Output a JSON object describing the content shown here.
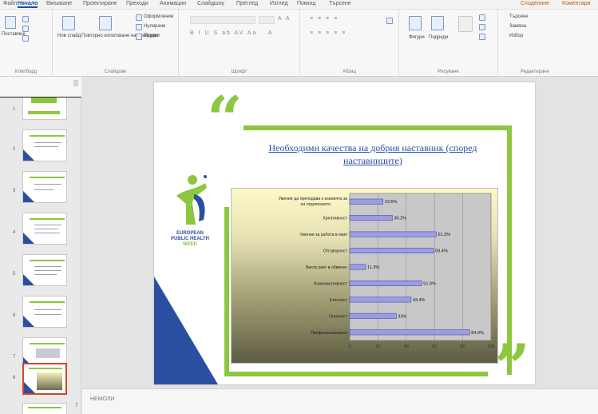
{
  "ribbon": {
    "tabs": [
      "Файл",
      "Начало",
      "Вмъкване",
      "Проектиране",
      "Преходи",
      "Анимации",
      "Слайдшоу",
      "Преглед",
      "Изглед",
      "Помощ",
      "Търсене"
    ],
    "active_tab": "Начало",
    "share_label": "Споделяне",
    "comments_label": "Коментари",
    "clipboard": {
      "paste": "Поставяне",
      "label": "Клипборд"
    },
    "slides": {
      "new_slide": "Нов слайд",
      "reuse": "Повторно използване на слайдове",
      "layout": "Оформление",
      "reset": "Нулиране",
      "section": "Раздел",
      "label": "Слайдове"
    },
    "font": {
      "label": "Шрифт"
    },
    "paragraph": {
      "label": "Абзац"
    },
    "drawing": {
      "shapes": "Фигури",
      "arrange": "Подреди",
      "label": "Рисуване"
    },
    "editing": {
      "find": "Търсене",
      "replace": "Замяна",
      "select": "Избор",
      "label": "Редактиране"
    }
  },
  "thumbnails": {
    "numbers": [
      "1",
      "2",
      "3",
      "4",
      "5",
      "6",
      "7",
      "8"
    ],
    "selected_index": 7
  },
  "slide": {
    "title": "Необходими качества на добрия наставник (според наставниците)",
    "logo_lines": [
      "EUROPEAN",
      "PUBLIC HEALTH"
    ],
    "logo_weeks": "WEEK"
  },
  "chart_data": {
    "type": "bar",
    "orientation": "horizontal",
    "categories": [
      "Умение да преподава к знанията за на отделението",
      "Креативност",
      "Умение за работа в екип",
      "Отговорност",
      "Висок ранг в обвинен",
      "Комуникативност",
      "Етичност",
      "Опитност",
      "Професионализъм"
    ],
    "values": [
      23.6,
      30.2,
      61.3,
      59.4,
      11.3,
      51.0,
      43.4,
      33.0,
      84.9
    ],
    "value_labels": [
      "23.6%",
      "30.2%",
      "61.3%",
      "59.4%",
      "11.3%",
      "51.0%",
      "43.4%",
      "33%",
      "84.9%"
    ],
    "xlim": [
      0,
      100
    ],
    "ticks": [
      "0",
      "20",
      "40",
      "60",
      "80",
      "100"
    ],
    "bar_color": "#9c9ce6",
    "grid": true
  },
  "notes": {
    "placeholder": "НЕМОЛИ"
  },
  "bottom_marker": "7"
}
